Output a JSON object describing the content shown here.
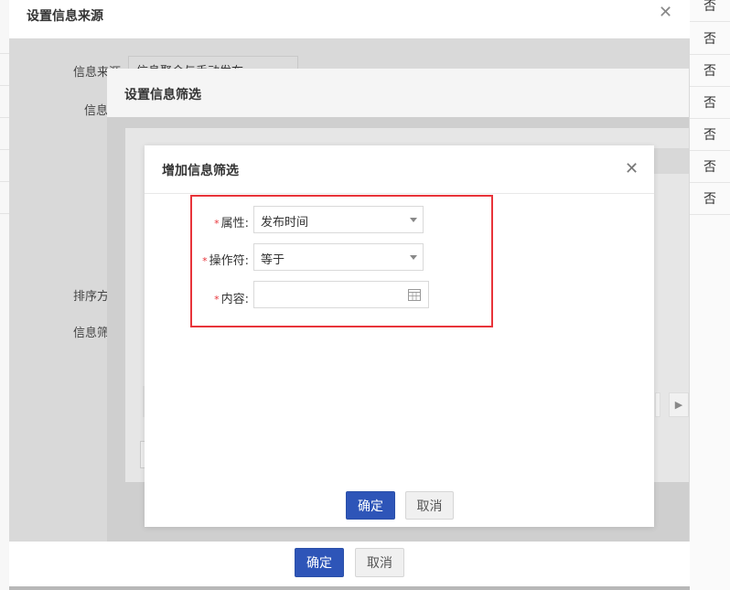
{
  "background_table": {
    "column_values": [
      "否",
      "否",
      "否",
      "否",
      "否",
      "否",
      "否"
    ]
  },
  "dialog_source": {
    "title": "设置信息来源",
    "fields": {
      "source_label": "信息来源:",
      "source_value": "信息聚合与手动发布",
      "filter_label_partial": "信息",
      "sort_label_partial": "排序方",
      "info_filter_label_partial": "信息筛"
    },
    "confirm_label": "确定",
    "cancel_label": "取消"
  },
  "dialog_filter": {
    "title": "设置信息筛选"
  },
  "dialog_add_filter": {
    "title": "增加信息筛选",
    "fields": {
      "attribute_label": "属性:",
      "attribute_value": "发布时间",
      "operator_label": "操作符:",
      "operator_value": "等于",
      "content_label": "内容:",
      "content_value": ""
    },
    "required_mark": "*",
    "confirm_label": "确定",
    "cancel_label": "取消"
  },
  "colors": {
    "primary": "#2e55b8",
    "required": "#e8343a",
    "highlight_box": "#e8343a"
  }
}
